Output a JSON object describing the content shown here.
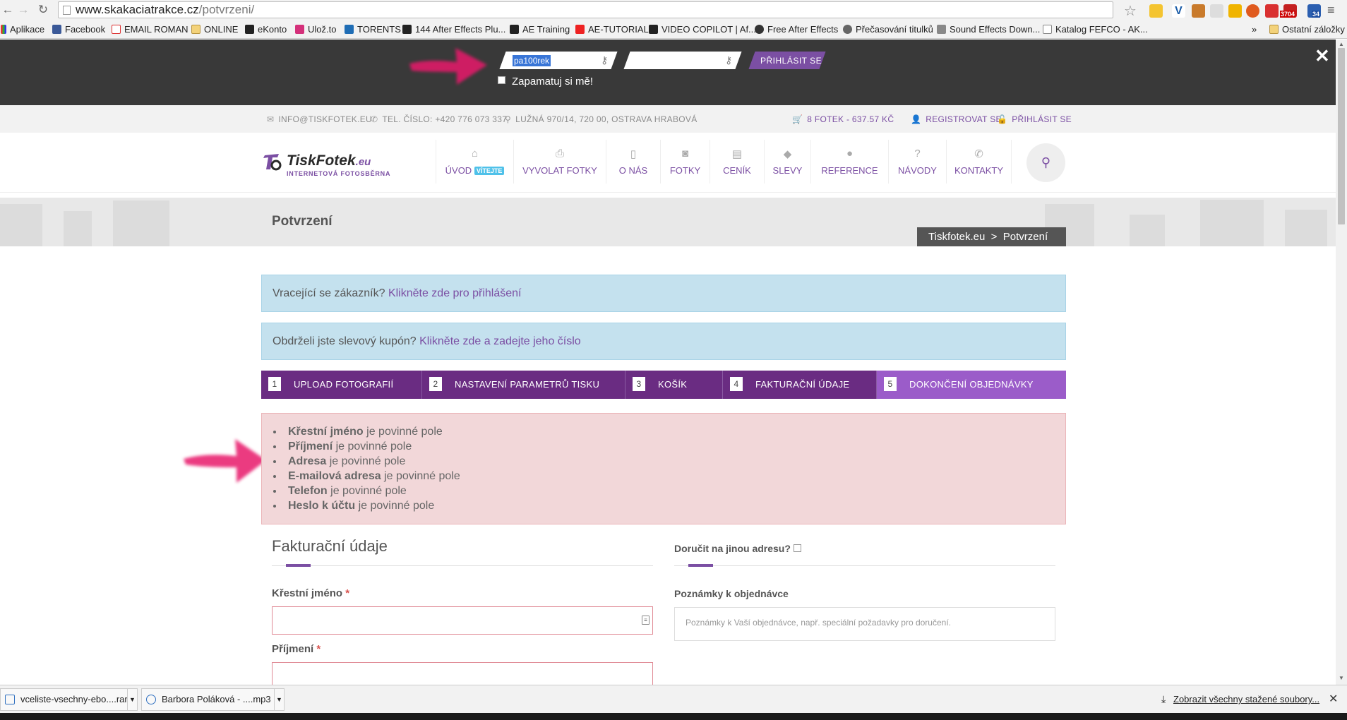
{
  "browser": {
    "url_domain": "www.skakaciatrakce.cz",
    "url_path": "/potvrzeni/",
    "bookmarks": [
      "Aplikace",
      "Facebook",
      "EMAIL ROMAN",
      "ONLINE",
      "eKonto",
      "Ulož.to",
      "TORENTS",
      "144 After Effects Plu...",
      "AE Training",
      "AE-TUTORIAL",
      "VIDEO COPILOT | Af...",
      "Free After Effects",
      "Přečasování titulků",
      "Sound Effects Down...",
      "Katalog FEFCO - AK...",
      "»",
      "Ostatní záložky"
    ],
    "ext_badges": [
      "3704",
      "34"
    ]
  },
  "login": {
    "username_value": "pa100rek",
    "password_value": "",
    "login_button": "PŘIHLÁSIT SE",
    "remember_label": "Zapamatuj si mě!",
    "close": "✕"
  },
  "infobar": {
    "email": "INFO@TISKFOTEK.EU",
    "phone": "TEL. ČÍSLO: +420 776 073 337",
    "address": "LUŽNÁ 970/14, 720 00, OSTRAVA HRABOVÁ",
    "cart": "8 FOTEK - 637.57 KČ",
    "register": "REGISTROVAT SE",
    "login": "PŘIHLÁSIT SE"
  },
  "header": {
    "logo_main": "TiskFotek",
    "logo_tld": ".eu",
    "logo_sub": "INTERNETOVÁ  FOTOSBĚRNA",
    "menu": [
      {
        "label": "ÚVOD",
        "badge": "VÍTEJTE",
        "icon": "home-icon"
      },
      {
        "label": "VYVOLAT FOTKY",
        "icon": "print-icon"
      },
      {
        "label": "O NÁS",
        "icon": "phone-device-icon"
      },
      {
        "label": "FOTKY",
        "icon": "camera-icon"
      },
      {
        "label": "CENÍK",
        "icon": "list-icon"
      },
      {
        "label": "SLEVY",
        "icon": "tag-icon"
      },
      {
        "label": "REFERENCE",
        "icon": "comment-icon"
      },
      {
        "label": "NÁVODY",
        "icon": "question-icon"
      },
      {
        "label": "KONTAKTY",
        "icon": "phone-icon"
      }
    ]
  },
  "banner": {
    "title": "Potvrzení",
    "breadcrumb_home": "Tiskfotek.eu",
    "breadcrumb_sep": ">",
    "breadcrumb_current": "Potvrzení"
  },
  "notices": {
    "returning_text": "Vracející se zákazník?",
    "returning_link": "Klikněte zde pro přihlášení",
    "coupon_text": "Obdrželi jste slevový kupón?",
    "coupon_link": "Klikněte zde a zadejte jeho číslo"
  },
  "steps": [
    {
      "num": "1",
      "label": "UPLOAD FOTOGRAFIÍ"
    },
    {
      "num": "2",
      "label": "NASTAVENÍ PARAMETRŮ TISKU"
    },
    {
      "num": "3",
      "label": "KOŠÍK"
    },
    {
      "num": "4",
      "label": "FAKTURAČNÍ ÚDAJE"
    },
    {
      "num": "5",
      "label": "DOKONČENÍ OBJEDNÁVKY"
    }
  ],
  "errors": {
    "suffix": "je povinné pole",
    "fields": [
      "Křestní jméno",
      "Příjmení",
      "Adresa",
      "E-mailová adresa",
      "Telefon",
      "Heslo k účtu"
    ]
  },
  "billing": {
    "title": "Fakturační údaje",
    "first_name_label": "Křestní jméno",
    "last_name_label": "Příjmení",
    "required_mark": "*"
  },
  "shipping": {
    "other_address_label": "Doručit na jinou adresu?",
    "notes_label": "Poznámky k objednávce",
    "notes_placeholder": "Poznámky k Vaší objednávce, např. speciální požadavky pro doručení."
  },
  "downloads": {
    "items": [
      "vceliste-vsechny-ebo....rar",
      "Barbora Poláková - ....mp3"
    ],
    "show_all": "Zobrazit všechny stažené soubory...",
    "close": "✕"
  },
  "colors": {
    "accent": "#7b4fa3",
    "step_bar": "#6a2c82",
    "step_active": "#9b5cc9",
    "error_bg": "#f2d7d9",
    "notice_bg": "#c4e1ee",
    "arrow": "#e8196b"
  }
}
